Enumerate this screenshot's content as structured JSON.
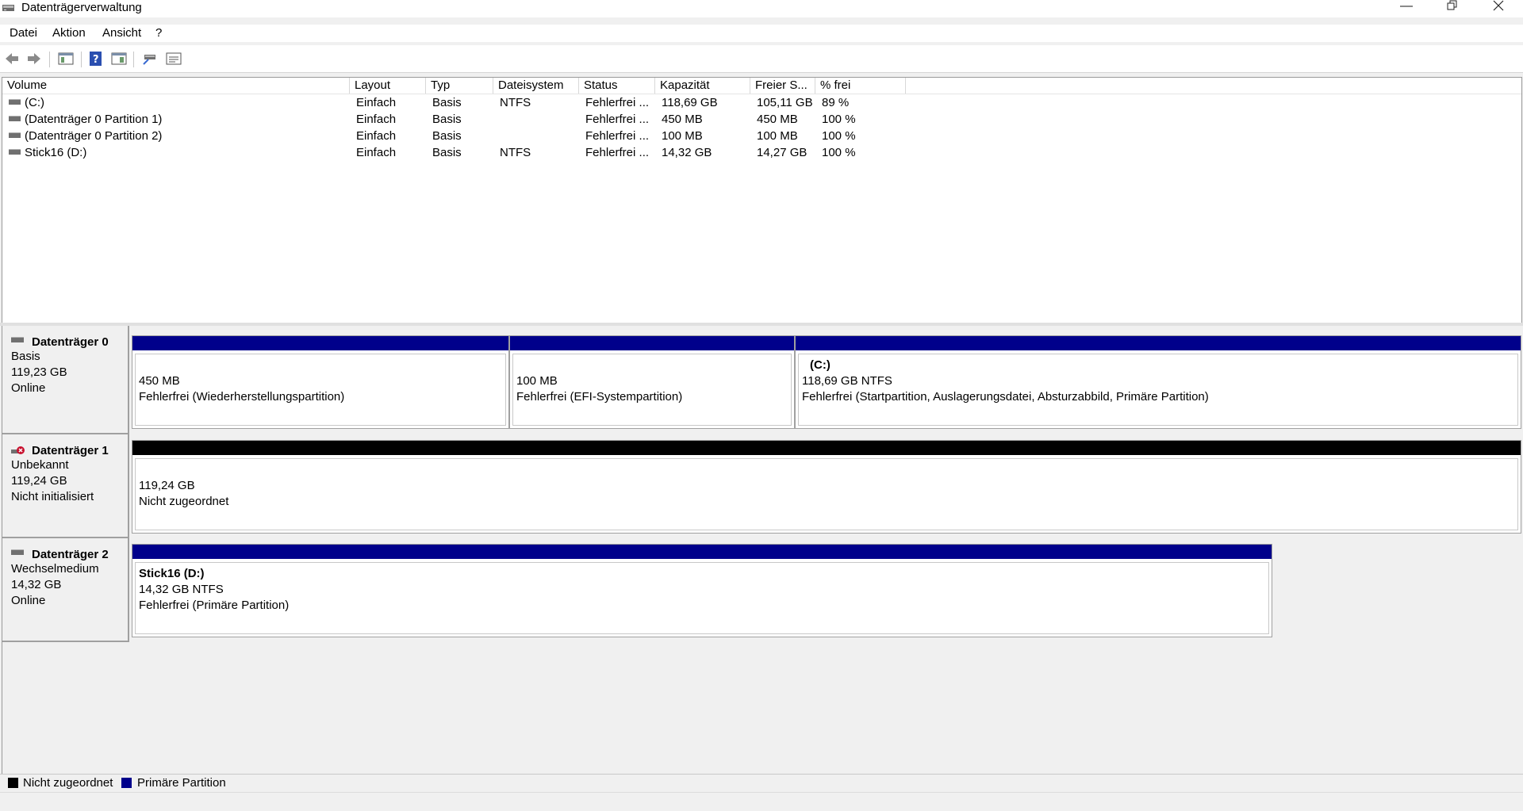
{
  "window": {
    "title": "Datenträgerverwaltung",
    "minimize_icon": "minimize-icon",
    "restore_icon": "restore-icon",
    "close_icon": "close-icon"
  },
  "menu": {
    "items": [
      "Datei",
      "Aktion",
      "Ansicht",
      "?"
    ]
  },
  "toolbar": {
    "icons": [
      "back-arrow-icon",
      "forward-arrow-icon",
      "console-tree-icon",
      "help-icon",
      "properties-icon",
      "connect-icon",
      "settings-list-icon"
    ]
  },
  "volume_list": {
    "columns": [
      "Volume",
      "Layout",
      "Typ",
      "Dateisystem",
      "Status",
      "Kapazität",
      "Freier S...",
      "% frei"
    ],
    "rows": [
      [
        "(C:)",
        "Einfach",
        "Basis",
        "NTFS",
        "Fehlerfrei ...",
        "118,69 GB",
        "105,11 GB",
        "89 %"
      ],
      [
        "(Datenträger 0 Partition 1)",
        "Einfach",
        "Basis",
        "",
        "Fehlerfrei ...",
        "450 MB",
        "450 MB",
        "100 %"
      ],
      [
        "(Datenträger 0 Partition 2)",
        "Einfach",
        "Basis",
        "",
        "Fehlerfrei ...",
        "100 MB",
        "100 MB",
        "100 %"
      ],
      [
        "Stick16 (D:)",
        "Einfach",
        "Basis",
        "NTFS",
        "Fehlerfrei ...",
        "14,32 GB",
        "14,27 GB",
        "100 %"
      ]
    ]
  },
  "disks": [
    {
      "name": "Datenträger 0",
      "type": "Basis",
      "size": "119,23 GB",
      "state": "Online",
      "partitions": [
        {
          "title": "",
          "line1": "450 MB",
          "line2": "Fehlerfrei (Wiederherstellungspartition)"
        },
        {
          "title": "",
          "line1": "100 MB",
          "line2": "Fehlerfrei (EFI-Systempartition)"
        },
        {
          "title": "(C:)",
          "line1": "118,69 GB NTFS",
          "line2": "Fehlerfrei (Startpartition, Auslagerungsdatei, Absturzabbild, Primäre Partition)"
        }
      ]
    },
    {
      "name": "Datenträger 1",
      "type": "Unbekannt",
      "size": "119,24 GB",
      "state": "Nicht initialisiert",
      "partitions": [
        {
          "title": "",
          "line1": "119,24 GB",
          "line2": "Nicht zugeordnet"
        }
      ]
    },
    {
      "name": "Datenträger 2",
      "type": "Wechselmedium",
      "size": "14,32 GB",
      "state": "Online",
      "partitions": [
        {
          "title": "Stick16  (D:)",
          "line1": "14,32 GB NTFS",
          "line2": "Fehlerfrei (Primäre Partition)"
        }
      ]
    }
  ],
  "legend": {
    "unallocated": "Nicht zugeordnet",
    "primary": "Primäre Partition"
  },
  "colors": {
    "primary_partition": "#00008b",
    "unallocated": "#000000"
  }
}
